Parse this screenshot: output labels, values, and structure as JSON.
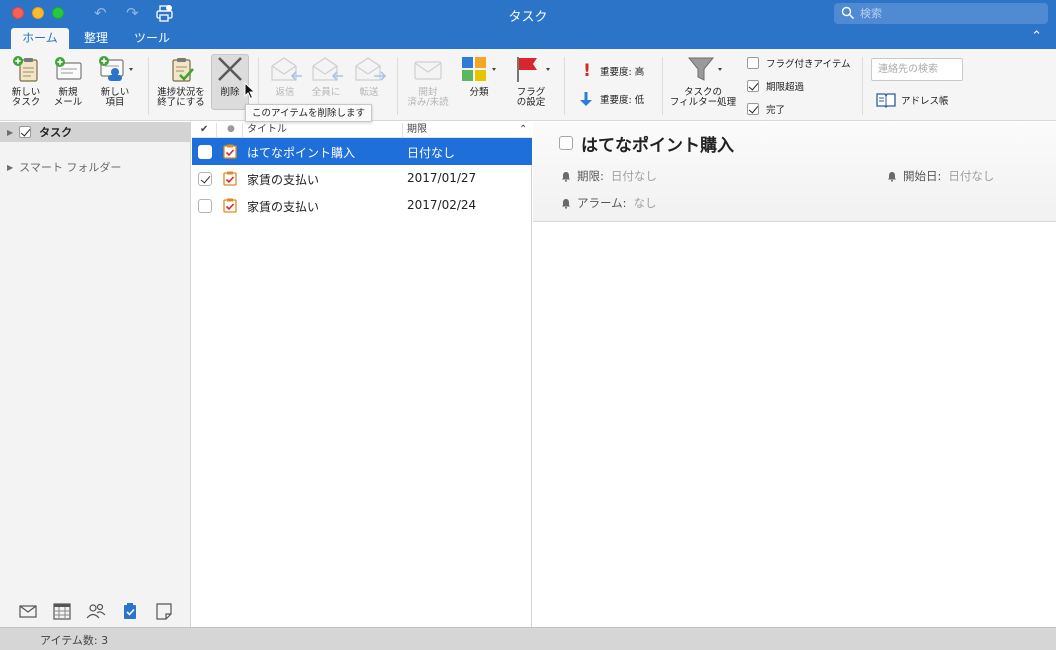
{
  "window": {
    "title": "タスク"
  },
  "search": {
    "placeholder": "検索"
  },
  "tabs": [
    {
      "label": "ホーム",
      "active": true
    },
    {
      "label": "整理",
      "active": false
    },
    {
      "label": "ツール",
      "active": false
    }
  ],
  "ribbon": {
    "new_task": [
      "新しい",
      "タスク"
    ],
    "new_email": [
      "新規",
      "メール"
    ],
    "new_item": [
      "新しい",
      "項目"
    ],
    "mark_complete": [
      "進捗状況を",
      "終了にする"
    ],
    "delete": "削除",
    "reply": "返信",
    "reply_all": "全員に",
    "forward": "転送",
    "read_unread": [
      "開封",
      "済み/未読"
    ],
    "categorize": "分類",
    "followup": [
      "フラグ",
      "の設定"
    ],
    "high_importance": "重要度: 高",
    "low_importance": "重要度: 低",
    "filter": [
      "タスクの",
      "フィルター処理"
    ],
    "filter_options": [
      {
        "label": "フラグ付きアイテム",
        "checked": false
      },
      {
        "label": "期限超過",
        "checked": true
      },
      {
        "label": "完了",
        "checked": true
      }
    ],
    "contact_search_placeholder": "連絡先の検索",
    "address_book": "アドレス帳",
    "tooltip": "このアイテムを削除します"
  },
  "sidebar": {
    "items": [
      {
        "label": "タスク",
        "checked": true,
        "selected": true
      },
      {
        "label": "スマート フォルダー"
      }
    ],
    "nav_icons": [
      "mail-icon",
      "calendar-icon",
      "people-icon",
      "tasks-icon",
      "notes-icon"
    ]
  },
  "list": {
    "columns": {
      "title": "タイトル",
      "due": "期限"
    },
    "rows": [
      {
        "title": "はてなポイント購入",
        "due": "日付なし",
        "done": false,
        "selected": true
      },
      {
        "title": "家賃の支払い",
        "due": "2017/01/27",
        "done": true,
        "selected": false
      },
      {
        "title": "家賃の支払い",
        "due": "2017/02/24",
        "done": false,
        "selected": false
      }
    ]
  },
  "detail": {
    "title": "はてなポイント購入",
    "due_label": "期限:",
    "due_value": "日付なし",
    "start_label": "開始日:",
    "start_value": "日付なし",
    "alarm_label": "アラーム:",
    "alarm_value": "なし"
  },
  "status": {
    "item_count": "アイテム数: 3"
  },
  "colors": {
    "accent": "#2b74c8",
    "selection": "#1e6fd9"
  }
}
